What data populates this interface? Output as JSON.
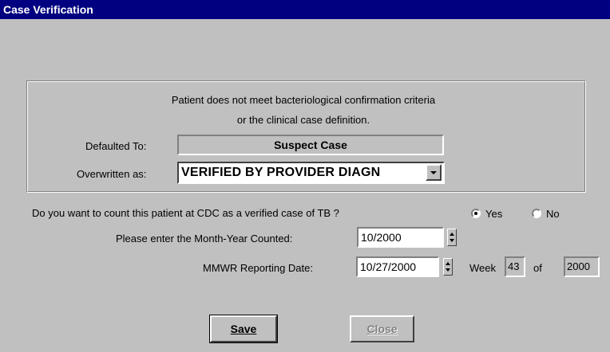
{
  "window": {
    "title": "Case Verification"
  },
  "criteria": {
    "message_line1": "Patient does not meet bacteriological confirmation criteria",
    "message_line2": "or the clinical case definition.",
    "defaulted_label": "Defaulted To:",
    "defaulted_value": "Suspect Case",
    "overwritten_label": "Overwritten as:",
    "overwritten_value": "VERIFIED BY PROVIDER DIAGN"
  },
  "count_question": {
    "text": "Do you want to count this patient at CDC as a verified case of TB ?",
    "yes_label": "Yes",
    "no_label": "No",
    "selected": "Yes"
  },
  "month_year": {
    "label": "Please enter the Month-Year Counted:",
    "value": "10/2000"
  },
  "mmwr": {
    "label": "MMWR Reporting Date:",
    "value": "10/27/2000",
    "week_label": "Week",
    "week_value": "43",
    "of_label": "of",
    "year_value": "2000"
  },
  "buttons": {
    "save": "Save",
    "close": "Close"
  }
}
